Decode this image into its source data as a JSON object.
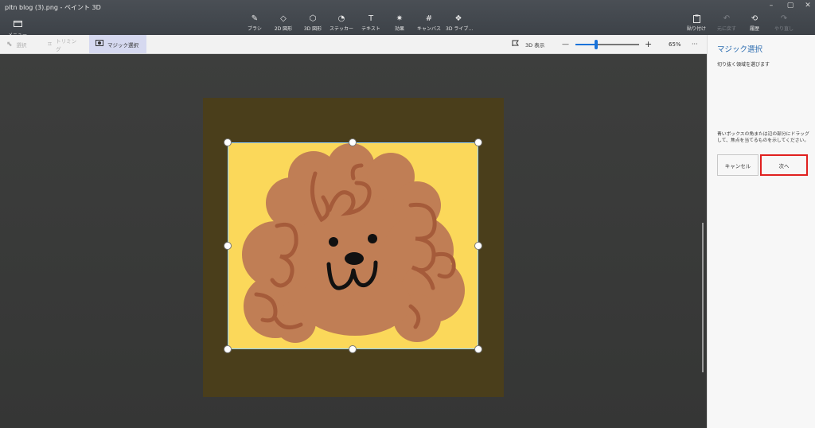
{
  "window": {
    "title": "pltn blog (3).png - ペイント 3D",
    "controls": [
      "–",
      "▢",
      "✕"
    ]
  },
  "menu": {
    "label": "メニュー"
  },
  "ribbon": {
    "tools": [
      {
        "name": "brush",
        "label": "ブラシ",
        "icon": "✎"
      },
      {
        "name": "2d-shapes",
        "label": "2D 図形",
        "icon": "◇"
      },
      {
        "name": "3d-shapes",
        "label": "3D 図形",
        "icon": "⬡"
      },
      {
        "name": "stickers",
        "label": "ステッカー",
        "icon": "◔"
      },
      {
        "name": "text",
        "label": "テキスト",
        "icon": "T"
      },
      {
        "name": "effects",
        "label": "効果",
        "icon": "✷"
      },
      {
        "name": "canvas",
        "label": "キャンバス",
        "icon": "#"
      },
      {
        "name": "3d-library",
        "label": "3D ライブ…",
        "icon": "❖"
      }
    ],
    "right": [
      {
        "name": "paste",
        "label": "貼り付け",
        "icon": "📋",
        "enabled": true
      },
      {
        "name": "undo",
        "label": "元に戻す",
        "icon": "↶",
        "enabled": false
      },
      {
        "name": "history",
        "label": "履歴",
        "icon": "⟲",
        "enabled": true
      },
      {
        "name": "redo",
        "label": "やり直し",
        "icon": "↷",
        "enabled": false
      }
    ]
  },
  "subbar": {
    "select": "選択",
    "crop": "トリミング",
    "magic_select": "マジック選択",
    "view_3d": "3D 表示",
    "zoom_out": "—",
    "zoom_in": "+",
    "zoom_level": "65%",
    "zoom_fraction": 0.33,
    "more": "···"
  },
  "panel": {
    "title": "マジック選択",
    "subtitle": "切り抜く領域を選びます",
    "hint": "青いボックスの角または辺の部分にドラッグして、焦点を当てるものを示してください。",
    "cancel_label": "キャンセル",
    "next_label": "次へ"
  },
  "colors": {
    "accent": "#1a73d9",
    "highlight_box": "#e0201f",
    "canvas_bg": "#4a3e1b",
    "image_bg": "#fbd85a",
    "dog_fur": "#c07e55",
    "dog_curl": "#a55b3a"
  }
}
